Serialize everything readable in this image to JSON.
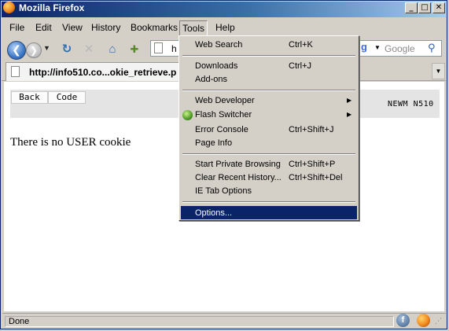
{
  "window": {
    "title": "Mozilla Firefox",
    "minimize": "_",
    "maximize": "□",
    "close": "✕"
  },
  "menubar": [
    {
      "label": "File"
    },
    {
      "label": "Edit"
    },
    {
      "label": "View"
    },
    {
      "label": "History"
    },
    {
      "label": "Bookmarks"
    },
    {
      "label": "Tools"
    },
    {
      "label": "Help"
    }
  ],
  "nav": {
    "back_glyph": "❮",
    "forward_glyph": "❯",
    "dropdown_glyph": "▼",
    "reload_glyph": "↻",
    "stop_glyph": "✕",
    "home_glyph": "⌂",
    "bookmark_glyph": "✚",
    "url_partial": "h"
  },
  "search": {
    "engine_glyph": "g",
    "dropdown_glyph": "▼",
    "placeholder": "Google",
    "go_glyph": "⚲"
  },
  "tab": {
    "title": "http://info510.co...okie_retrieve.p",
    "list_glyph": "▼"
  },
  "page": {
    "buttons": [
      {
        "label": "Back"
      },
      {
        "label": "Code"
      }
    ],
    "brand": "NEWM N510",
    "message": "There is no USER cookie"
  },
  "status": {
    "text": "Done",
    "flash_glyph": "f",
    "grip_glyph": "⋰"
  },
  "tools_menu": {
    "items": [
      {
        "label": "Web Search",
        "shortcut": "Ctrl+K"
      },
      {
        "label": "Downloads",
        "shortcut": "Ctrl+J"
      },
      {
        "label": "Add-ons",
        "shortcut": ""
      },
      {
        "label": "Web Developer",
        "shortcut": "",
        "submenu": "▶"
      },
      {
        "label": "Flash Switcher",
        "shortcut": "",
        "submenu": "▶"
      },
      {
        "label": "Error Console",
        "shortcut": "Ctrl+Shift+J"
      },
      {
        "label": "Page Info",
        "shortcut": ""
      },
      {
        "label": "Start Private Browsing",
        "shortcut": "Ctrl+Shift+P"
      },
      {
        "label": "Clear Recent History...",
        "shortcut": "Ctrl+Shift+Del"
      },
      {
        "label": "IE Tab Options",
        "shortcut": ""
      },
      {
        "label": "Options...",
        "shortcut": ""
      }
    ]
  }
}
